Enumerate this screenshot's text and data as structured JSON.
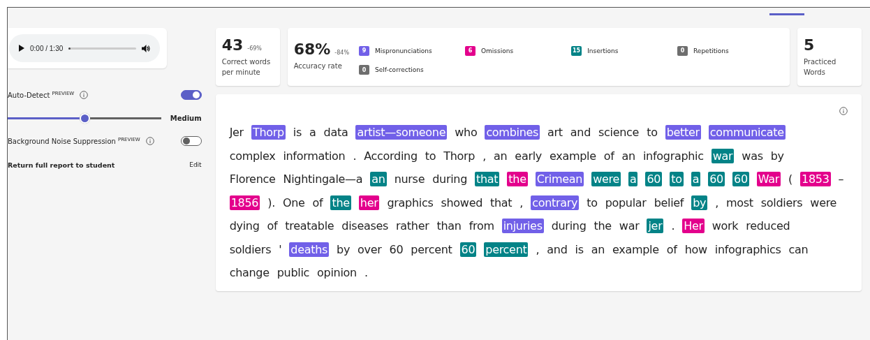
{
  "audio": {
    "time": "0:00 / 1:30",
    "level": 0.02
  },
  "settings": [
    {
      "kind": "toggle",
      "label": "Auto-Detect",
      "tag": "PREVIEW",
      "on": true
    },
    {
      "kind": "slider",
      "level": 0.5,
      "reading": "Medium"
    },
    {
      "kind": "toggle",
      "label": "Background Noise Suppression",
      "tag": "PREVIEW",
      "on": false
    },
    {
      "kind": "link",
      "label": "Return full report to student",
      "action": "Edit"
    }
  ],
  "stats": [
    {
      "kind": "metric",
      "value": "43",
      "change": "-69%",
      "label": "Correct words per minute"
    },
    {
      "kind": "errors",
      "value": "68%",
      "change": "-84%",
      "label": "Accuracy rate",
      "errors": [
        {
          "count": "9",
          "label": "Mispronunciations",
          "color": "#7160e8"
        },
        {
          "count": "6",
          "label": "Omissions",
          "color": "#e3008c"
        },
        {
          "count": "15",
          "label": "Insertions",
          "color": "#038387"
        },
        {
          "count": "0",
          "label": "Repetitions",
          "color": "#6e6e6e"
        },
        {
          "count": "0",
          "label": "Self-corrections",
          "color": "#6e6e6e"
        }
      ]
    },
    {
      "kind": "metric",
      "value": "5",
      "label": "Practiced Words"
    }
  ],
  "passage": {
    "lines": [
      [
        {
          "text": "Jer",
          "kind": "plain"
        },
        {
          "text": "Thorp",
          "kind": "mispronunciation"
        },
        {
          "text": "is",
          "kind": "plain"
        },
        {
          "text": "a",
          "kind": "plain"
        },
        {
          "text": "data",
          "kind": "plain"
        },
        {
          "text": "artist—someone",
          "kind": "mispronunciation"
        },
        {
          "text": "who",
          "kind": "plain"
        },
        {
          "text": "combines",
          "kind": "mispronunciation"
        },
        {
          "text": "art",
          "kind": "plain"
        },
        {
          "text": "and",
          "kind": "plain"
        },
        {
          "text": "science",
          "kind": "plain"
        },
        {
          "text": "to",
          "kind": "plain"
        },
        {
          "text": "better",
          "kind": "mispronunciation"
        },
        {
          "text": "communicate",
          "kind": "mispronunciation"
        }
      ],
      [
        {
          "text": "complex",
          "kind": "plain"
        },
        {
          "text": "information",
          "kind": "plain"
        },
        {
          "text": ".",
          "kind": "plain"
        },
        {
          "text": "According",
          "kind": "plain"
        },
        {
          "text": "to",
          "kind": "plain"
        },
        {
          "text": "Thorp",
          "kind": "plain"
        },
        {
          "text": ",",
          "kind": "plain"
        },
        {
          "text": "an",
          "kind": "plain"
        },
        {
          "text": "early",
          "kind": "plain"
        },
        {
          "text": "example",
          "kind": "plain"
        },
        {
          "text": "of",
          "kind": "plain"
        },
        {
          "text": "an",
          "kind": "plain"
        },
        {
          "text": "infographic",
          "kind": "plain"
        },
        {
          "text": "war",
          "kind": "insertion"
        },
        {
          "text": "was",
          "kind": "plain"
        },
        {
          "text": "by",
          "kind": "plain"
        }
      ],
      [
        {
          "text": "Florence",
          "kind": "plain"
        },
        {
          "text": "Nightingale—a",
          "kind": "plain"
        },
        {
          "text": "an",
          "kind": "insertion"
        },
        {
          "text": "nurse",
          "kind": "plain"
        },
        {
          "text": "during",
          "kind": "plain"
        },
        {
          "text": "that",
          "kind": "insertion"
        },
        {
          "text": "the",
          "kind": "omission"
        },
        {
          "text": "Crimean",
          "kind": "mispronunciation"
        },
        {
          "text": "were",
          "kind": "insertion"
        },
        {
          "text": "a",
          "kind": "insertion"
        },
        {
          "text": "60",
          "kind": "insertion"
        },
        {
          "text": "to",
          "kind": "insertion"
        },
        {
          "text": "a",
          "kind": "insertion"
        },
        {
          "text": "60",
          "kind": "insertion"
        },
        {
          "text": "60",
          "kind": "insertion"
        },
        {
          "text": "War",
          "kind": "omission"
        },
        {
          "text": "(",
          "kind": "plain"
        },
        {
          "text": "1853",
          "kind": "omission"
        },
        {
          "text": "–",
          "kind": "plain"
        }
      ],
      [
        {
          "text": "1856",
          "kind": "omission"
        },
        {
          "text": ").",
          "kind": "plain"
        },
        {
          "text": "One",
          "kind": "plain"
        },
        {
          "text": "of",
          "kind": "plain"
        },
        {
          "text": "the",
          "kind": "insertion"
        },
        {
          "text": "her",
          "kind": "omission"
        },
        {
          "text": "graphics",
          "kind": "plain"
        },
        {
          "text": "showed",
          "kind": "plain"
        },
        {
          "text": "that",
          "kind": "plain"
        },
        {
          "text": ",",
          "kind": "plain"
        },
        {
          "text": "contrary",
          "kind": "mispronunciation"
        },
        {
          "text": "to",
          "kind": "plain"
        },
        {
          "text": "popular",
          "kind": "plain"
        },
        {
          "text": "belief",
          "kind": "plain"
        },
        {
          "text": "by",
          "kind": "insertion"
        },
        {
          "text": ",",
          "kind": "plain"
        },
        {
          "text": "most",
          "kind": "plain"
        },
        {
          "text": "soldiers",
          "kind": "plain"
        },
        {
          "text": "were",
          "kind": "plain"
        }
      ],
      [
        {
          "text": "dying",
          "kind": "plain"
        },
        {
          "text": "of",
          "kind": "plain"
        },
        {
          "text": "treatable",
          "kind": "plain"
        },
        {
          "text": "diseases",
          "kind": "plain"
        },
        {
          "text": "rather",
          "kind": "plain"
        },
        {
          "text": "than",
          "kind": "plain"
        },
        {
          "text": "from",
          "kind": "plain"
        },
        {
          "text": "injuries",
          "kind": "mispronunciation"
        },
        {
          "text": "during",
          "kind": "plain"
        },
        {
          "text": "the",
          "kind": "plain"
        },
        {
          "text": "war",
          "kind": "plain"
        },
        {
          "text": "jer",
          "kind": "insertion"
        },
        {
          "text": ".",
          "kind": "plain"
        },
        {
          "text": "Her",
          "kind": "omission"
        },
        {
          "text": "work",
          "kind": "plain"
        },
        {
          "text": "reduced",
          "kind": "plain"
        }
      ],
      [
        {
          "text": "soldiers",
          "kind": "plain"
        },
        {
          "text": "'",
          "kind": "plain"
        },
        {
          "text": "deaths",
          "kind": "mispronunciation"
        },
        {
          "text": "by",
          "kind": "plain"
        },
        {
          "text": "over",
          "kind": "plain"
        },
        {
          "text": "60",
          "kind": "plain"
        },
        {
          "text": "percent",
          "kind": "plain"
        },
        {
          "text": "60",
          "kind": "insertion"
        },
        {
          "text": "percent",
          "kind": "insertion"
        },
        {
          "text": ",",
          "kind": "plain"
        },
        {
          "text": "and",
          "kind": "plain"
        },
        {
          "text": "is",
          "kind": "plain"
        },
        {
          "text": "an",
          "kind": "plain"
        },
        {
          "text": "example",
          "kind": "plain"
        },
        {
          "text": "of",
          "kind": "plain"
        },
        {
          "text": "how",
          "kind": "plain"
        },
        {
          "text": "infographics",
          "kind": "plain"
        },
        {
          "text": "can",
          "kind": "plain"
        }
      ],
      [
        {
          "text": "change",
          "kind": "plain"
        },
        {
          "text": "public",
          "kind": "plain"
        },
        {
          "text": "opinion",
          "kind": "plain"
        },
        {
          "text": ".",
          "kind": "plain"
        }
      ]
    ]
  }
}
